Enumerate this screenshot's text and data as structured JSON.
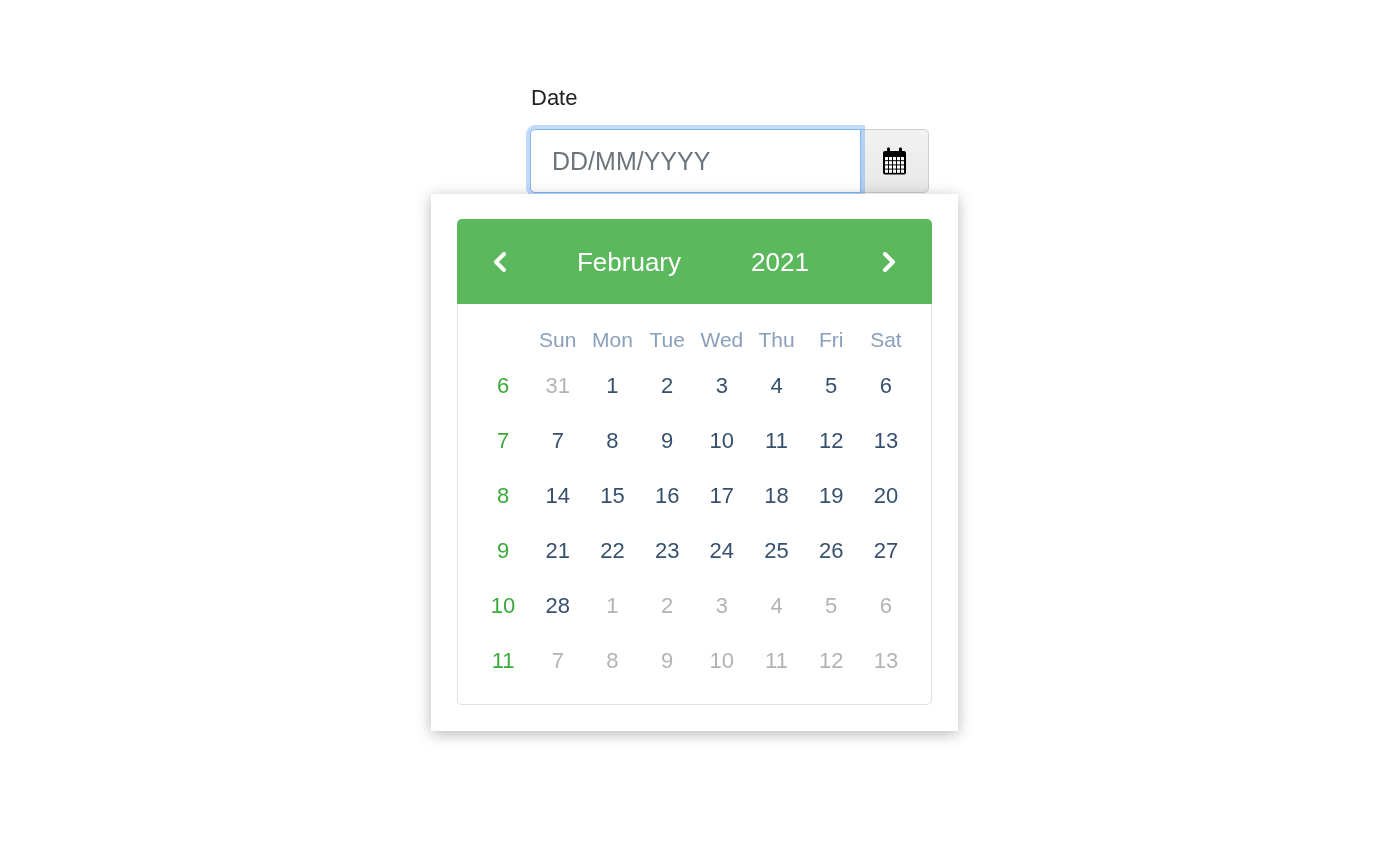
{
  "field": {
    "label": "Date",
    "placeholder": "DD/MM/YYYY",
    "focused": true
  },
  "calendar": {
    "month": "February",
    "year": "2021",
    "weekdays": [
      "Sun",
      "Mon",
      "Tue",
      "Wed",
      "Thu",
      "Fri",
      "Sat"
    ],
    "weeks": [
      {
        "number": "6",
        "days": [
          {
            "label": "31",
            "outside_month": true
          },
          {
            "label": "1",
            "outside_month": false
          },
          {
            "label": "2",
            "outside_month": false
          },
          {
            "label": "3",
            "outside_month": false
          },
          {
            "label": "4",
            "outside_month": false
          },
          {
            "label": "5",
            "outside_month": false
          },
          {
            "label": "6",
            "outside_month": false
          }
        ]
      },
      {
        "number": "7",
        "days": [
          {
            "label": "7",
            "outside_month": false
          },
          {
            "label": "8",
            "outside_month": false
          },
          {
            "label": "9",
            "outside_month": false
          },
          {
            "label": "10",
            "outside_month": false
          },
          {
            "label": "11",
            "outside_month": false
          },
          {
            "label": "12",
            "outside_month": false
          },
          {
            "label": "13",
            "outside_month": false
          }
        ]
      },
      {
        "number": "8",
        "days": [
          {
            "label": "14",
            "outside_month": false
          },
          {
            "label": "15",
            "outside_month": false
          },
          {
            "label": "16",
            "outside_month": false
          },
          {
            "label": "17",
            "outside_month": false
          },
          {
            "label": "18",
            "outside_month": false
          },
          {
            "label": "19",
            "outside_month": false
          },
          {
            "label": "20",
            "outside_month": false
          }
        ]
      },
      {
        "number": "9",
        "days": [
          {
            "label": "21",
            "outside_month": false
          },
          {
            "label": "22",
            "outside_month": false
          },
          {
            "label": "23",
            "outside_month": false
          },
          {
            "label": "24",
            "outside_month": false
          },
          {
            "label": "25",
            "outside_month": false
          },
          {
            "label": "26",
            "outside_month": false
          },
          {
            "label": "27",
            "outside_month": false
          }
        ]
      },
      {
        "number": "10",
        "days": [
          {
            "label": "28",
            "outside_month": false
          },
          {
            "label": "1",
            "outside_month": true
          },
          {
            "label": "2",
            "outside_month": true
          },
          {
            "label": "3",
            "outside_month": true
          },
          {
            "label": "4",
            "outside_month": true
          },
          {
            "label": "5",
            "outside_month": true
          },
          {
            "label": "6",
            "outside_month": true
          }
        ]
      },
      {
        "number": "11",
        "days": [
          {
            "label": "7",
            "outside_month": true
          },
          {
            "label": "8",
            "outside_month": true
          },
          {
            "label": "9",
            "outside_month": true
          },
          {
            "label": "10",
            "outside_month": true
          },
          {
            "label": "11",
            "outside_month": true
          },
          {
            "label": "12",
            "outside_month": true
          },
          {
            "label": "13",
            "outside_month": true
          }
        ]
      }
    ]
  }
}
